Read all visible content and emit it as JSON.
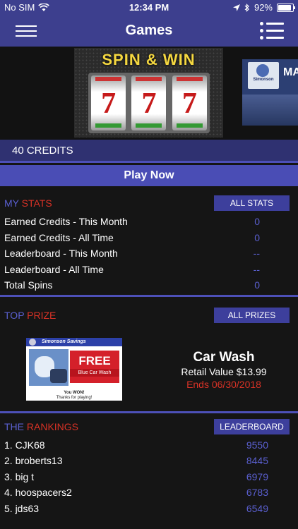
{
  "status": {
    "carrier": "No SIM",
    "time": "12:34 PM",
    "battery": "92%"
  },
  "nav": {
    "title": "Games"
  },
  "banner": {
    "spin_title": "SPIN & WIN",
    "reel_symbol": "7",
    "next_card_text": "MA",
    "next_card_logo": "Simonson"
  },
  "credits": {
    "label": "40 CREDITS"
  },
  "play": {
    "label": "Play Now"
  },
  "stats": {
    "title_part1": "MY ",
    "title_part2": "STATS",
    "button": "ALL STATS",
    "rows": [
      {
        "label": "Earned Credits - This Month",
        "value": "0"
      },
      {
        "label": "Earned Credits - All Time",
        "value": "0"
      },
      {
        "label": "Leaderboard - This Month",
        "value": "--"
      },
      {
        "label": "Leaderboard - All Time",
        "value": "--"
      },
      {
        "label": "Total Spins",
        "value": "0"
      }
    ]
  },
  "prize": {
    "title_part1": "TOP ",
    "title_part2": "PRIZE",
    "button": "ALL PRIZES",
    "name": "Car Wash",
    "retail": "Retail Value $13.99",
    "ends": "Ends 06/30/2018",
    "coupon": {
      "header": "Simonson Savings",
      "free": "FREE",
      "free_sub": "Blue Car Wash",
      "won": "You WON!",
      "thanks": "Thanks for playing!"
    }
  },
  "rankings": {
    "title_part1": "THE ",
    "title_part2": "RANKINGS",
    "button": "LEADERBOARD",
    "rows": [
      {
        "name": "1. CJK68",
        "score": "9550"
      },
      {
        "name": "2. broberts13",
        "score": "8445"
      },
      {
        "name": "3. big t",
        "score": "6979"
      },
      {
        "name": "4. hoospacers2",
        "score": "6783"
      },
      {
        "name": "5. jds63",
        "score": "6549"
      }
    ]
  }
}
